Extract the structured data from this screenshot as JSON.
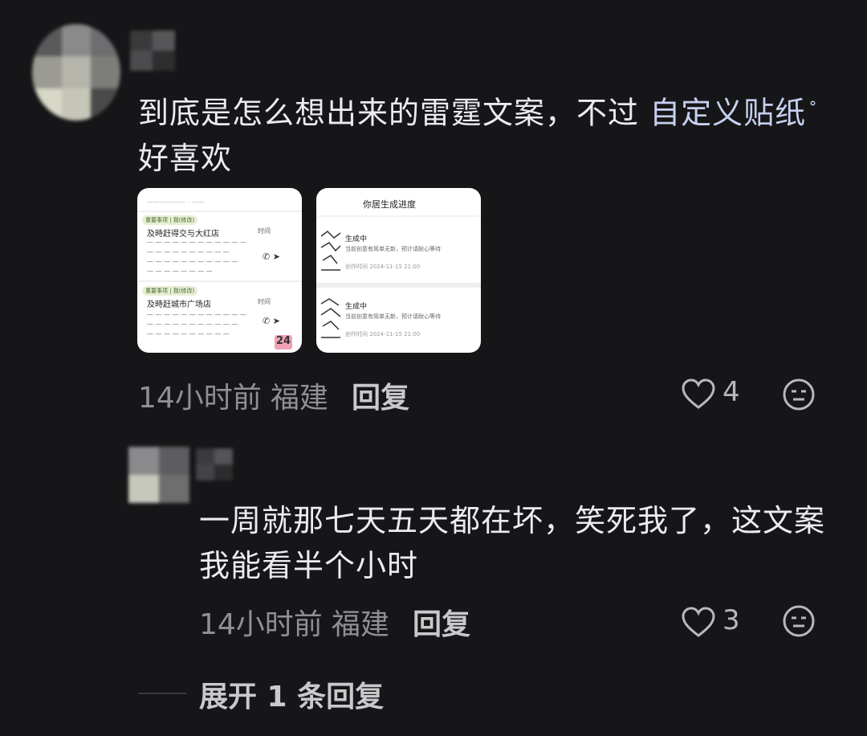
{
  "comments": [
    {
      "text_before": "到底是怎么想出来的雷霆文案，不过 ",
      "link_text": "自定义贴纸",
      "text_after": "好喜欢",
      "time": "14小时前",
      "location": "福建",
      "reply_label": "回复",
      "likes": "4",
      "images": [
        {
          "cards": [
            {
              "tag": "重要事项 | 我(修改)",
              "title": "及時赶得交与大红店",
              "time_label": "时间",
              "badge_text": ""
            },
            {
              "tag": "重要事项 | 我(修改)",
              "title": "及時赶城市广场店",
              "time_label": "时间",
              "badge_text": "24"
            }
          ]
        },
        {
          "header": "你居生成进度",
          "rows": [
            {
              "status": "生成中",
              "desc": "当前创意有简单无新，预计请耐心等待",
              "time": "创作时间  2024-11-15 21:00"
            },
            {
              "status": "生成中",
              "desc": "当前创意有简单无新，预计请耐心等待",
              "time": "创作时间  2024-11-15 21:00"
            }
          ]
        }
      ]
    },
    {
      "text": "一周就那七天五天都在坏，笑死我了，这文案我能看半个小时",
      "time": "14小时前",
      "location": "福建",
      "reply_label": "回复",
      "likes": "3"
    }
  ],
  "expand_label": "展开 1 条回复",
  "icons": {
    "heart": "heart-icon",
    "emoji": "emoji-reaction-icon",
    "search": "search-icon"
  },
  "colors": {
    "background": "#161618",
    "link": "#c6d0ef",
    "meta": "#8f8f94"
  }
}
